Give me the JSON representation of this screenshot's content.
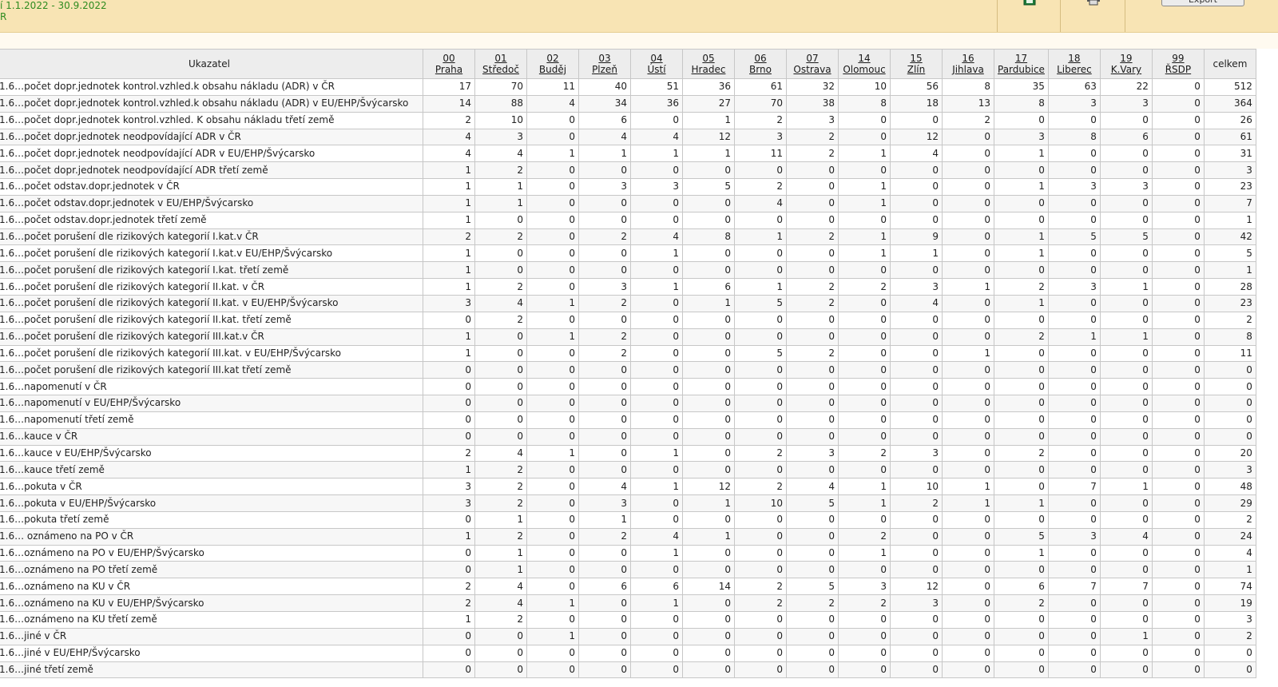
{
  "header": {
    "period_text": "í 1.1.2022 - 30.9.2022",
    "scope_text": "R",
    "export_label": "Export",
    "icons": [
      "excel-icon",
      "print-icon"
    ]
  },
  "table": {
    "indicator_header": "Ukazatel",
    "total_header": "celkem",
    "regions": [
      {
        "code": "00",
        "name": "Praha"
      },
      {
        "code": "01",
        "name": "Středoč"
      },
      {
        "code": "02",
        "name": "Buděj"
      },
      {
        "code": "03",
        "name": "Plzeň"
      },
      {
        "code": "04",
        "name": "Ústí"
      },
      {
        "code": "05",
        "name": "Hradec"
      },
      {
        "code": "06",
        "name": "Brno"
      },
      {
        "code": "07",
        "name": "Ostrava"
      },
      {
        "code": "14",
        "name": "Olomouc"
      },
      {
        "code": "15",
        "name": "Zlín"
      },
      {
        "code": "16",
        "name": "Jihlava"
      },
      {
        "code": "17",
        "name": "Pardubice"
      },
      {
        "code": "18",
        "name": "Liberec"
      },
      {
        "code": "19",
        "name": "K.Vary"
      },
      {
        "code": "99",
        "name": "ŘSDP"
      }
    ],
    "rows": [
      {
        "label": "1.6…počet dopr.jednotek kontrol.vzhled.k obsahu nákladu (ADR) v ČR",
        "values": [
          "17",
          "70",
          "11",
          "40",
          "51",
          "36",
          "61",
          "32",
          "10",
          "56",
          "8",
          "35",
          "63",
          "22",
          "0",
          "512"
        ]
      },
      {
        "label": "1.6…počet dopr.jednotek kontrol.vzhled.k obsahu nákladu (ADR) v EU/EHP/Švýcarsko",
        "values": [
          "14",
          "88",
          "4",
          "34",
          "36",
          "27",
          "70",
          "38",
          "8",
          "18",
          "13",
          "8",
          "3",
          "3",
          "0",
          "364"
        ]
      },
      {
        "label": "1.6…počet dopr.jednotek kontrol.vzhled. K obsahu nákladu třetí země",
        "values": [
          "2",
          "10",
          "0",
          "6",
          "0",
          "1",
          "2",
          "3",
          "0",
          "0",
          "2",
          "0",
          "0",
          "0",
          "0",
          "26"
        ]
      },
      {
        "label": "1.6…počet dopr.jednotek neodpovídající ADR v ČR",
        "values": [
          "4",
          "3",
          "0",
          "4",
          "4",
          "12",
          "3",
          "2",
          "0",
          "12",
          "0",
          "3",
          "8",
          "6",
          "0",
          "61"
        ]
      },
      {
        "label": "1.6…počet dopr.jednotek neodpovídající ADR v EU/EHP/Švýcarsko",
        "values": [
          "4",
          "4",
          "1",
          "1",
          "1",
          "1",
          "11",
          "2",
          "1",
          "4",
          "0",
          "1",
          "0",
          "0",
          "0",
          "31"
        ]
      },
      {
        "label": "1.6…počet dopr.jednotek neodpovídající ADR třetí země",
        "values": [
          "1",
          "2",
          "0",
          "0",
          "0",
          "0",
          "0",
          "0",
          "0",
          "0",
          "0",
          "0",
          "0",
          "0",
          "0",
          "3"
        ]
      },
      {
        "label": "1.6…počet odstav.dopr.jednotek v ČR",
        "values": [
          "1",
          "1",
          "0",
          "3",
          "3",
          "5",
          "2",
          "0",
          "1",
          "0",
          "0",
          "1",
          "3",
          "3",
          "0",
          "23"
        ]
      },
      {
        "label": "1.6…počet odstav.dopr.jednotek v EU/EHP/Švýcarsko",
        "values": [
          "1",
          "1",
          "0",
          "0",
          "0",
          "0",
          "4",
          "0",
          "1",
          "0",
          "0",
          "0",
          "0",
          "0",
          "0",
          "7"
        ]
      },
      {
        "label": "1.6…počet odstav.dopr.jednotek třetí země",
        "values": [
          "1",
          "0",
          "0",
          "0",
          "0",
          "0",
          "0",
          "0",
          "0",
          "0",
          "0",
          "0",
          "0",
          "0",
          "0",
          "1"
        ]
      },
      {
        "label": "1.6…počet porušení dle rizikových kategorií I.kat.v ČR",
        "values": [
          "2",
          "2",
          "0",
          "2",
          "4",
          "8",
          "1",
          "2",
          "1",
          "9",
          "0",
          "1",
          "5",
          "5",
          "0",
          "42"
        ]
      },
      {
        "label": "1.6…počet porušení dle rizikových kategorií I.kat.v EU/EHP/Švýcarsko",
        "values": [
          "1",
          "0",
          "0",
          "0",
          "1",
          "0",
          "0",
          "0",
          "1",
          "1",
          "0",
          "1",
          "0",
          "0",
          "0",
          "5"
        ]
      },
      {
        "label": "1.6…počet porušení dle rizikových kategorií I.kat. třetí země",
        "values": [
          "1",
          "0",
          "0",
          "0",
          "0",
          "0",
          "0",
          "0",
          "0",
          "0",
          "0",
          "0",
          "0",
          "0",
          "0",
          "1"
        ]
      },
      {
        "label": "1.6…počet porušení dle rizikových kategorií II.kat. v ČR",
        "values": [
          "1",
          "2",
          "0",
          "3",
          "1",
          "6",
          "1",
          "2",
          "2",
          "3",
          "1",
          "2",
          "3",
          "1",
          "0",
          "28"
        ]
      },
      {
        "label": "1.6…počet porušení dle rizikových kategorií II.kat. v EU/EHP/Švýcarsko",
        "values": [
          "3",
          "4",
          "1",
          "2",
          "0",
          "1",
          "5",
          "2",
          "0",
          "4",
          "0",
          "1",
          "0",
          "0",
          "0",
          "23"
        ]
      },
      {
        "label": "1.6…počet porušení dle rizikových kategorií II.kat. třetí země",
        "values": [
          "0",
          "2",
          "0",
          "0",
          "0",
          "0",
          "0",
          "0",
          "0",
          "0",
          "0",
          "0",
          "0",
          "0",
          "0",
          "2"
        ]
      },
      {
        "label": "1.6…počet porušení dle rizikových kategorií III.kat.v ČR",
        "values": [
          "1",
          "0",
          "1",
          "2",
          "0",
          "0",
          "0",
          "0",
          "0",
          "0",
          "0",
          "2",
          "1",
          "1",
          "0",
          "8"
        ]
      },
      {
        "label": "1.6…počet porušení dle rizikových kategorií III.kat. v EU/EHP/Švýcarsko",
        "values": [
          "1",
          "0",
          "0",
          "2",
          "0",
          "0",
          "5",
          "2",
          "0",
          "0",
          "1",
          "0",
          "0",
          "0",
          "0",
          "11"
        ]
      },
      {
        "label": "1.6…počet porušení dle rizikových kategorií III.kat třetí země",
        "values": [
          "0",
          "0",
          "0",
          "0",
          "0",
          "0",
          "0",
          "0",
          "0",
          "0",
          "0",
          "0",
          "0",
          "0",
          "0",
          "0"
        ]
      },
      {
        "label": "1.6…napomenutí v ČR",
        "values": [
          "0",
          "0",
          "0",
          "0",
          "0",
          "0",
          "0",
          "0",
          "0",
          "0",
          "0",
          "0",
          "0",
          "0",
          "0",
          "0"
        ]
      },
      {
        "label": "1.6…napomenutí v EU/EHP/Švýcarsko",
        "values": [
          "0",
          "0",
          "0",
          "0",
          "0",
          "0",
          "0",
          "0",
          "0",
          "0",
          "0",
          "0",
          "0",
          "0",
          "0",
          "0"
        ]
      },
      {
        "label": "1.6…napomenutí třetí země",
        "values": [
          "0",
          "0",
          "0",
          "0",
          "0",
          "0",
          "0",
          "0",
          "0",
          "0",
          "0",
          "0",
          "0",
          "0",
          "0",
          "0"
        ]
      },
      {
        "label": "1.6…kauce v ČR",
        "values": [
          "0",
          "0",
          "0",
          "0",
          "0",
          "0",
          "0",
          "0",
          "0",
          "0",
          "0",
          "0",
          "0",
          "0",
          "0",
          "0"
        ]
      },
      {
        "label": "1.6…kauce v EU/EHP/Švýcarsko",
        "values": [
          "2",
          "4",
          "1",
          "0",
          "1",
          "0",
          "2",
          "3",
          "2",
          "3",
          "0",
          "2",
          "0",
          "0",
          "0",
          "20"
        ]
      },
      {
        "label": "1.6…kauce třetí země",
        "values": [
          "1",
          "2",
          "0",
          "0",
          "0",
          "0",
          "0",
          "0",
          "0",
          "0",
          "0",
          "0",
          "0",
          "0",
          "0",
          "3"
        ]
      },
      {
        "label": "1.6…pokuta v ČR",
        "values": [
          "3",
          "2",
          "0",
          "4",
          "1",
          "12",
          "2",
          "4",
          "1",
          "10",
          "1",
          "0",
          "7",
          "1",
          "0",
          "48"
        ]
      },
      {
        "label": "1.6…pokuta v EU/EHP/Švýcarsko",
        "values": [
          "3",
          "2",
          "0",
          "3",
          "0",
          "1",
          "10",
          "5",
          "1",
          "2",
          "1",
          "1",
          "0",
          "0",
          "0",
          "29"
        ]
      },
      {
        "label": "1.6…pokuta třetí země",
        "values": [
          "0",
          "1",
          "0",
          "1",
          "0",
          "0",
          "0",
          "0",
          "0",
          "0",
          "0",
          "0",
          "0",
          "0",
          "0",
          "2"
        ]
      },
      {
        "label": "1.6… oznámeno na PO v ČR",
        "values": [
          "1",
          "2",
          "0",
          "2",
          "4",
          "1",
          "0",
          "0",
          "2",
          "0",
          "0",
          "5",
          "3",
          "4",
          "0",
          "24"
        ]
      },
      {
        "label": "1.6…oznámeno na PO v EU/EHP/Švýcarsko",
        "values": [
          "0",
          "1",
          "0",
          "0",
          "1",
          "0",
          "0",
          "0",
          "1",
          "0",
          "0",
          "1",
          "0",
          "0",
          "0",
          "4"
        ]
      },
      {
        "label": "1.6…oznámeno na PO třetí země",
        "values": [
          "0",
          "1",
          "0",
          "0",
          "0",
          "0",
          "0",
          "0",
          "0",
          "0",
          "0",
          "0",
          "0",
          "0",
          "0",
          "1"
        ]
      },
      {
        "label": "1.6…oznámeno na KU v ČR",
        "values": [
          "2",
          "4",
          "0",
          "6",
          "6",
          "14",
          "2",
          "5",
          "3",
          "12",
          "0",
          "6",
          "7",
          "7",
          "0",
          "74"
        ]
      },
      {
        "label": "1.6…oznámeno na KU v EU/EHP/Švýcarsko",
        "values": [
          "2",
          "4",
          "1",
          "0",
          "1",
          "0",
          "2",
          "2",
          "2",
          "3",
          "0",
          "2",
          "0",
          "0",
          "0",
          "19"
        ]
      },
      {
        "label": "1.6…oznámeno na KU třetí země",
        "values": [
          "1",
          "2",
          "0",
          "0",
          "0",
          "0",
          "0",
          "0",
          "0",
          "0",
          "0",
          "0",
          "0",
          "0",
          "0",
          "3"
        ]
      },
      {
        "label": "1.6…jiné v ČR",
        "values": [
          "0",
          "0",
          "1",
          "0",
          "0",
          "0",
          "0",
          "0",
          "0",
          "0",
          "0",
          "0",
          "0",
          "1",
          "0",
          "2"
        ]
      },
      {
        "label": "1.6…jiné v EU/EHP/Švýcarsko",
        "values": [
          "0",
          "0",
          "0",
          "0",
          "0",
          "0",
          "0",
          "0",
          "0",
          "0",
          "0",
          "0",
          "0",
          "0",
          "0",
          "0"
        ]
      },
      {
        "label": "1.6…jiné třetí země",
        "values": [
          "0",
          "0",
          "0",
          "0",
          "0",
          "0",
          "0",
          "0",
          "0",
          "0",
          "0",
          "0",
          "0",
          "0",
          "0",
          "0"
        ]
      }
    ]
  }
}
